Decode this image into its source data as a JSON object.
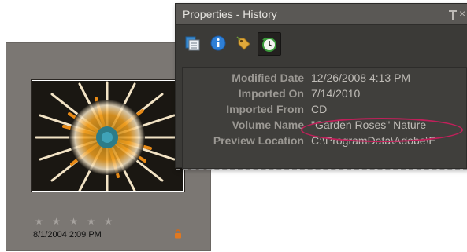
{
  "thumbnail": {
    "rating_stars": "★ ★ ★ ★ ★",
    "date": "8/1/2004 2:09 PM",
    "photo_icon": "flower-photo",
    "lock_icon": "padlock-icon"
  },
  "panel": {
    "title": "Properties - History",
    "pin_icon": "pin-icon",
    "close_label": "×",
    "tabs": [
      {
        "name": "general-tab",
        "icon": "document-icon"
      },
      {
        "name": "metadata-tab",
        "icon": "info-icon"
      },
      {
        "name": "keywords-tab",
        "icon": "tag-icon"
      },
      {
        "name": "history-tab",
        "icon": "history-clock-icon",
        "active": true
      }
    ],
    "history": {
      "modified_date_label": "Modified Date",
      "modified_date": "12/26/2008 4:13 PM",
      "imported_on_label": "Imported On",
      "imported_on": "7/14/2010",
      "imported_from_label": "Imported From",
      "imported_from": "CD",
      "volume_name_label": "Volume Name",
      "volume_name": "\"Garden Roses\" Nature",
      "preview_location_label": "Preview Location",
      "preview_location": "C:\\ProgramData\\Adobe\\E"
    }
  },
  "colors": {
    "highlight_ellipse": "#c0205a",
    "panel_bg": "#3b3a37",
    "thumbnail_bg": "#7b7773"
  }
}
